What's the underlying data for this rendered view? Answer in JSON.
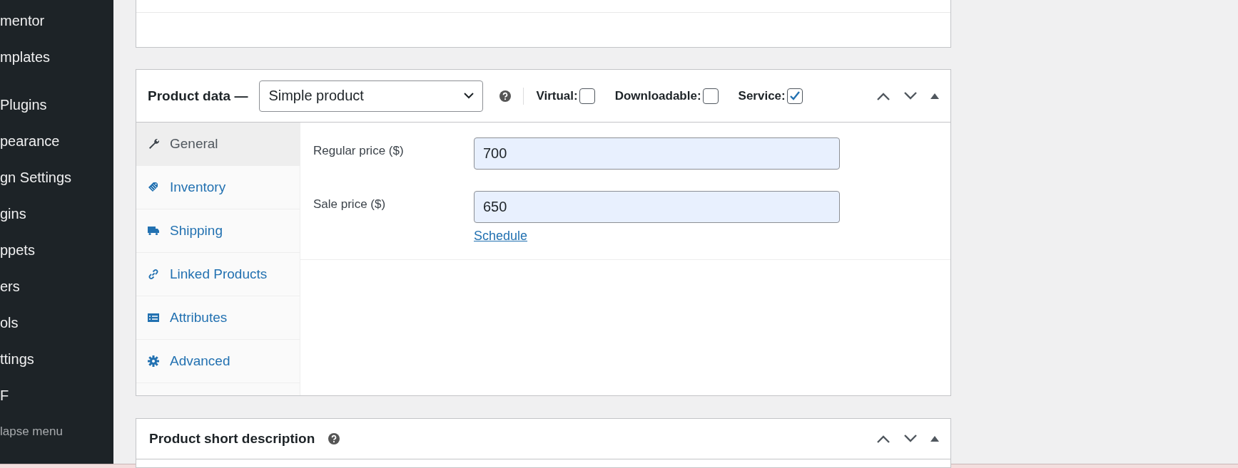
{
  "sidebar": {
    "items": [
      {
        "label": "mentor"
      },
      {
        "label": "mplates"
      },
      {
        "label": "Plugins"
      },
      {
        "label": "pearance"
      },
      {
        "label": "gn Settings"
      },
      {
        "label": "gins"
      },
      {
        "label": "ppets"
      },
      {
        "label": "ers"
      },
      {
        "label": "ols"
      },
      {
        "label": "ttings"
      },
      {
        "label": "F"
      },
      {
        "label": "lapse menu",
        "kind": "collapse"
      }
    ]
  },
  "product_data": {
    "title": "Product data —",
    "product_type": "Simple product",
    "options": [
      {
        "label": "Virtual:",
        "checked": false
      },
      {
        "label": "Downloadable:",
        "checked": false
      },
      {
        "label": "Service:",
        "checked": true
      }
    ],
    "tabs": [
      {
        "label": "General",
        "selected": true
      },
      {
        "label": "Inventory",
        "selected": false
      },
      {
        "label": "Shipping",
        "selected": false
      },
      {
        "label": "Linked Products",
        "selected": false
      },
      {
        "label": "Attributes",
        "selected": false
      },
      {
        "label": "Advanced",
        "selected": false
      }
    ],
    "fields": [
      {
        "label": "Regular price ($)",
        "value": "700"
      },
      {
        "label": "Sale price ($)",
        "value": "650",
        "link": "Schedule"
      }
    ]
  },
  "short_description": {
    "title": "Product short description"
  }
}
